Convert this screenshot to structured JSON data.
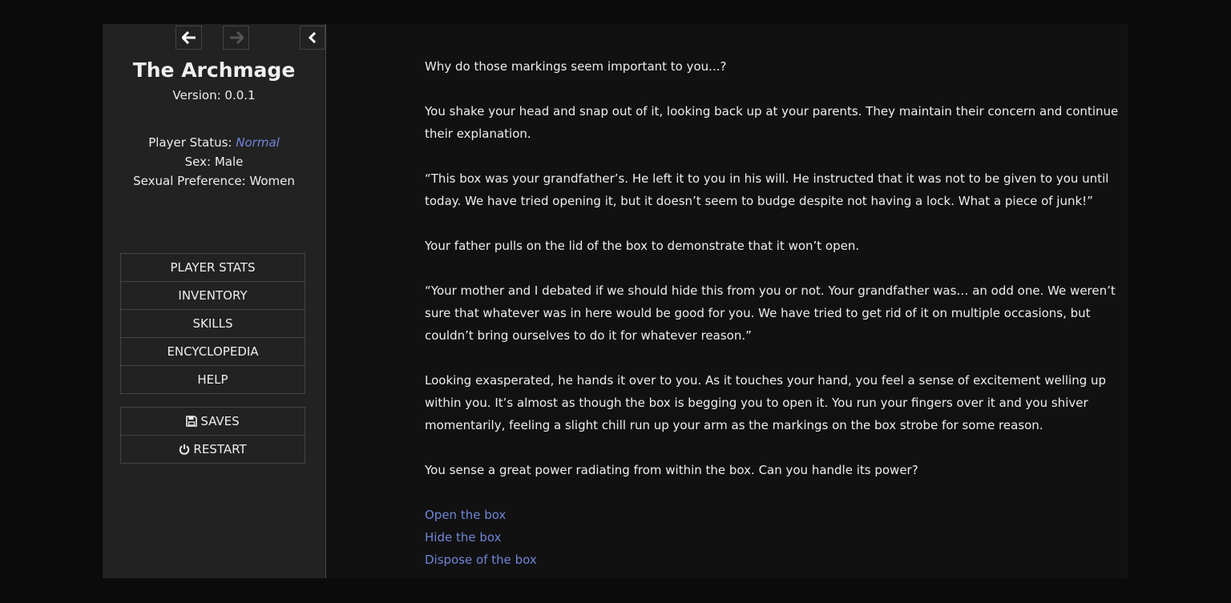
{
  "sidebar": {
    "title": "The Archmage",
    "version": "Version: 0.0.1",
    "status": {
      "player_status_label": "Player Status:",
      "player_status_value": "Normal",
      "sex": "Sex: Male",
      "preference": "Sexual Preference: Women"
    },
    "history": {
      "back_icon": "arrow-left-icon",
      "forward_icon": "arrow-right-icon",
      "toggle_icon": "chevron-left-icon"
    },
    "menu": [
      {
        "label": "PLAYER STATS"
      },
      {
        "label": "INVENTORY"
      },
      {
        "label": "SKILLS"
      },
      {
        "label": "ENCYCLOPEDIA"
      },
      {
        "label": "HELP"
      }
    ],
    "system_menu": [
      {
        "label": "SAVES",
        "icon": "floppy-disk-icon"
      },
      {
        "label": "RESTART",
        "icon": "power-icon"
      }
    ]
  },
  "story": {
    "paragraphs": [
      "Why do those markings seem important to you...?",
      "You shake your head and snap out of it, looking back up at your parents. They maintain their concern and continue their explanation.",
      "“This box was your grandfather’s. He left it to you in his will. He instructed that it was not to be given to you until today. We have tried opening it, but it doesn’t seem to budge despite not having a lock. What a piece of junk!”",
      "Your father pulls on the lid of the box to demonstrate that it won’t open.",
      "“Your mother and I debated if we should hide this from you or not. Your grandfather was… an odd one. We weren’t sure that whatever was in here would be good for you. We have tried to get rid of it on multiple occasions, but couldn’t bring ourselves to do it for whatever reason.”",
      "Looking exasperated, he hands it over to you. As it touches your hand, you feel a sense of excitement welling up within you. It’s almost as though the box is begging you to open it. You run your fingers over it and you shiver momentarily, feeling a slight chill run up your arm as the markings on the box strobe for some reason.",
      "You sense a great power radiating from within the box. Can you handle its power?"
    ],
    "choices": [
      "Open the box",
      "Hide the box",
      "Dispose of the box"
    ]
  },
  "colors": {
    "link": "#6f86d6",
    "sidebar_bg": "#222222",
    "page_bg": "#111111"
  }
}
